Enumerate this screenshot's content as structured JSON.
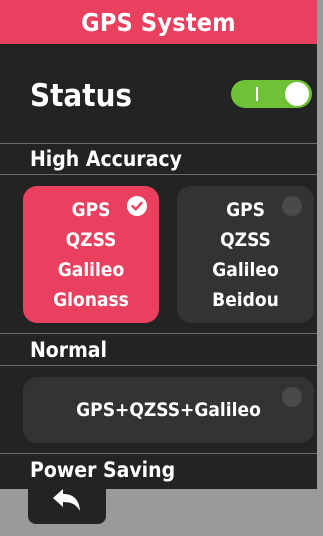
{
  "header": {
    "title": "GPS System"
  },
  "status": {
    "label": "Status",
    "toggle_on": true,
    "toggle_color": "#6fc135"
  },
  "sections": {
    "high_accuracy": {
      "title": "High Accuracy",
      "options": [
        {
          "lines": [
            "GPS",
            "QZSS",
            "Galileo",
            "Glonass"
          ],
          "selected": true
        },
        {
          "lines": [
            "GPS",
            "QZSS",
            "Galileo",
            "Beidou"
          ],
          "selected": false
        }
      ]
    },
    "normal": {
      "title": "Normal",
      "options": [
        {
          "label": "GPS+QZSS+Galileo",
          "selected": false
        }
      ]
    },
    "power_saving": {
      "title": "Power Saving"
    }
  },
  "footer": {
    "back_icon": "back-arrow-icon"
  },
  "colors": {
    "accent": "#e8405e",
    "background": "#232323",
    "card": "#333333"
  }
}
